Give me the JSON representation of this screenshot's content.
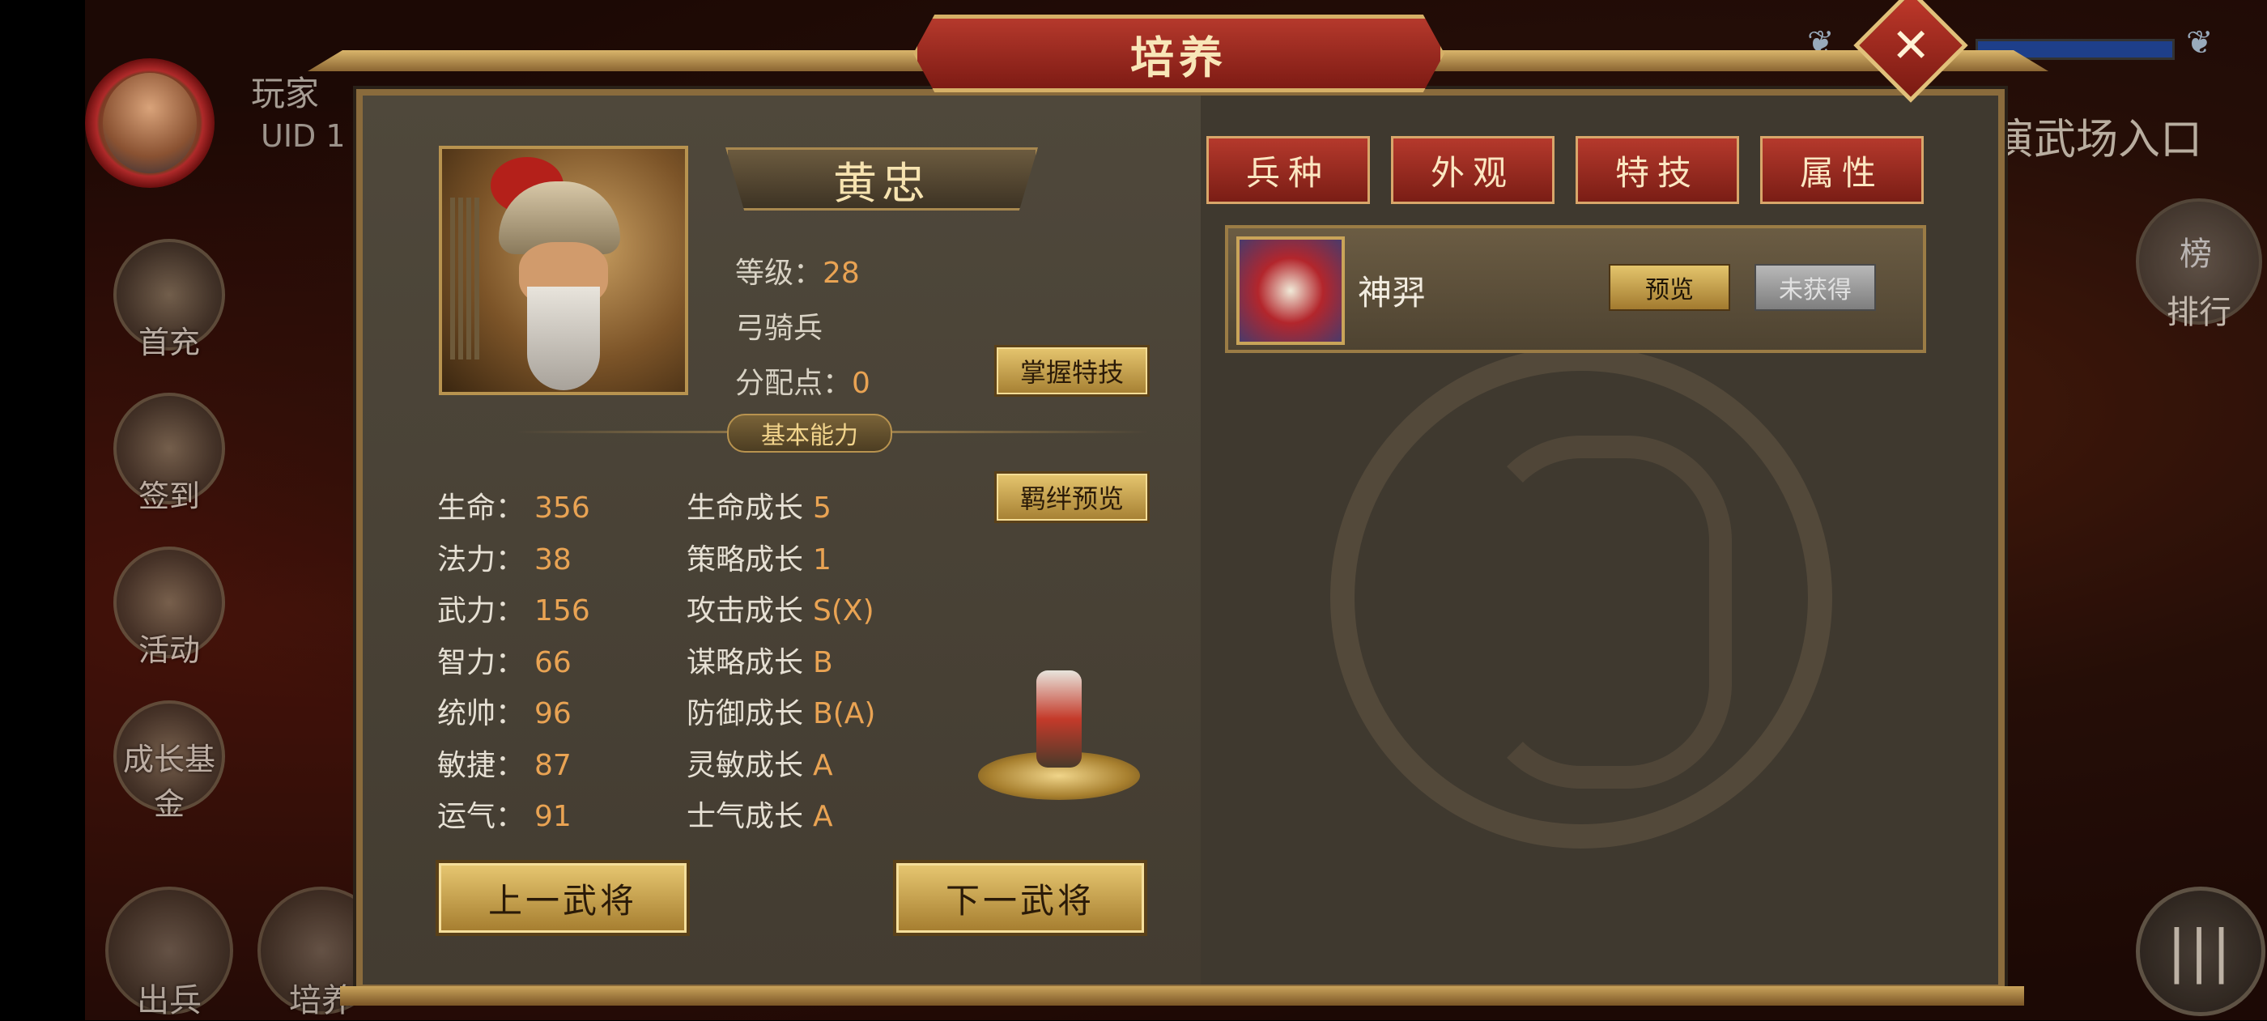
{
  "dialog": {
    "title": "培养"
  },
  "hud": {
    "player_name": "玩家",
    "uid": "UID 1",
    "side_buttons": [
      "首充",
      "签到",
      "活动",
      "成长基金"
    ],
    "bottom_buttons": [
      "出兵",
      "培养"
    ],
    "arena_entry": "演武场入口",
    "ranking": "排行",
    "ranking_badge": "榜"
  },
  "hero": {
    "name": "黄忠",
    "level_label": "等级：",
    "level": "28",
    "troop_type": "弓骑兵",
    "points_label": "分配点：",
    "points": "0"
  },
  "buttons": {
    "master_skill": "掌握特技",
    "bond_preview": "羁绊预览",
    "prev_general": "上一武将",
    "next_general": "下一武将"
  },
  "section": {
    "basic_ability": "基本能力"
  },
  "stats": [
    {
      "label": "生命：",
      "value": "356"
    },
    {
      "label": "法力：",
      "value": "38"
    },
    {
      "label": "武力：",
      "value": "156"
    },
    {
      "label": "智力：",
      "value": "66"
    },
    {
      "label": "统帅：",
      "value": "96"
    },
    {
      "label": "敏捷：",
      "value": "87"
    },
    {
      "label": "运气：",
      "value": "91"
    }
  ],
  "growth": [
    {
      "label": "生命成长",
      "value": "5"
    },
    {
      "label": "策略成长",
      "value": "1"
    },
    {
      "label": "攻击成长",
      "value": "S(X)"
    },
    {
      "label": "谋略成长",
      "value": "B"
    },
    {
      "label": "防御成长",
      "value": "B(A)"
    },
    {
      "label": "灵敏成长",
      "value": "A"
    },
    {
      "label": "士气成长",
      "value": "A"
    }
  ],
  "tabs": [
    "兵种",
    "外观",
    "特技",
    "属性"
  ],
  "troop": {
    "name": "神羿",
    "preview": "预览",
    "status": "未获得"
  }
}
